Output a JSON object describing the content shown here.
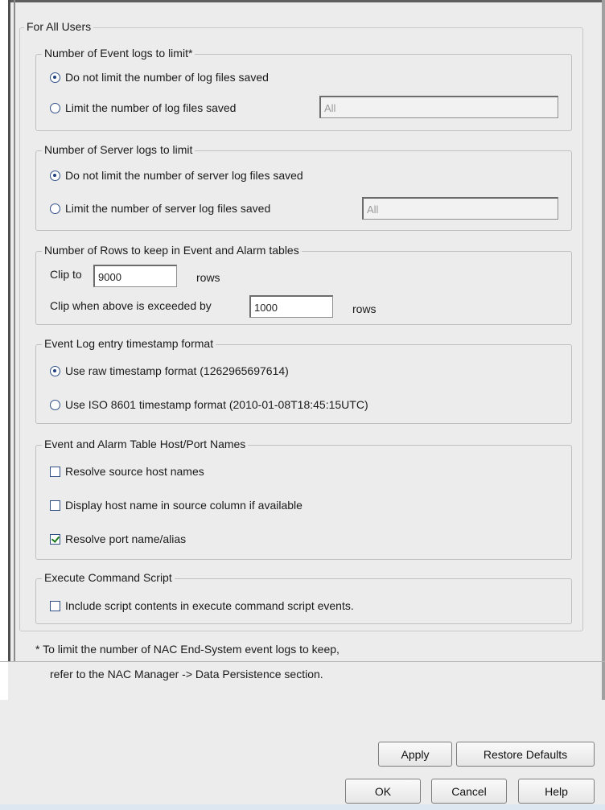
{
  "outer_group": {
    "title": "For All Users"
  },
  "event_logs": {
    "title": "Number of Event logs to limit*",
    "option_unlimited": "Do not limit the number of log files saved",
    "option_limit": "Limit the number of log files saved",
    "limit_value": "All",
    "selected": "unlimited"
  },
  "server_logs": {
    "title": "Number of Server logs to limit",
    "option_unlimited": "Do not limit the number of server log files saved",
    "option_limit": "Limit the number of server log files saved",
    "limit_value": "All",
    "selected": "unlimited"
  },
  "rows": {
    "title": "Number of Rows to keep in Event and Alarm tables",
    "clip_label": "Clip to",
    "clip_value": "9000",
    "clip_unit": "rows",
    "exceed_label": "Clip when above is exceeded by",
    "exceed_value": "1000",
    "exceed_unit": "rows"
  },
  "timestamp": {
    "title": "Event Log entry timestamp format",
    "option_raw": "Use raw timestamp format (1262965697614)",
    "option_iso": "Use ISO 8601 timestamp format (2010-01-08T18:45:15UTC)",
    "selected": "raw"
  },
  "host_port": {
    "title": "Event and Alarm Table Host/Port Names",
    "resolve_host": "Resolve source host names",
    "display_host": "Display host name in source column if available",
    "resolve_port": "Resolve port name/alias",
    "resolve_host_checked": false,
    "display_host_checked": false,
    "resolve_port_checked": true
  },
  "script": {
    "title": "Execute Command Script",
    "include_contents": "Include script contents in execute command script events.",
    "include_checked": false
  },
  "footnote": {
    "line1": "* To limit the number of NAC End-System event logs to keep,",
    "line2": "refer to the  NAC Manager -> Data Persistence section."
  },
  "buttons": {
    "apply": "Apply",
    "restore_defaults": "Restore Defaults",
    "ok": "OK",
    "cancel": "Cancel",
    "help": "Help"
  }
}
